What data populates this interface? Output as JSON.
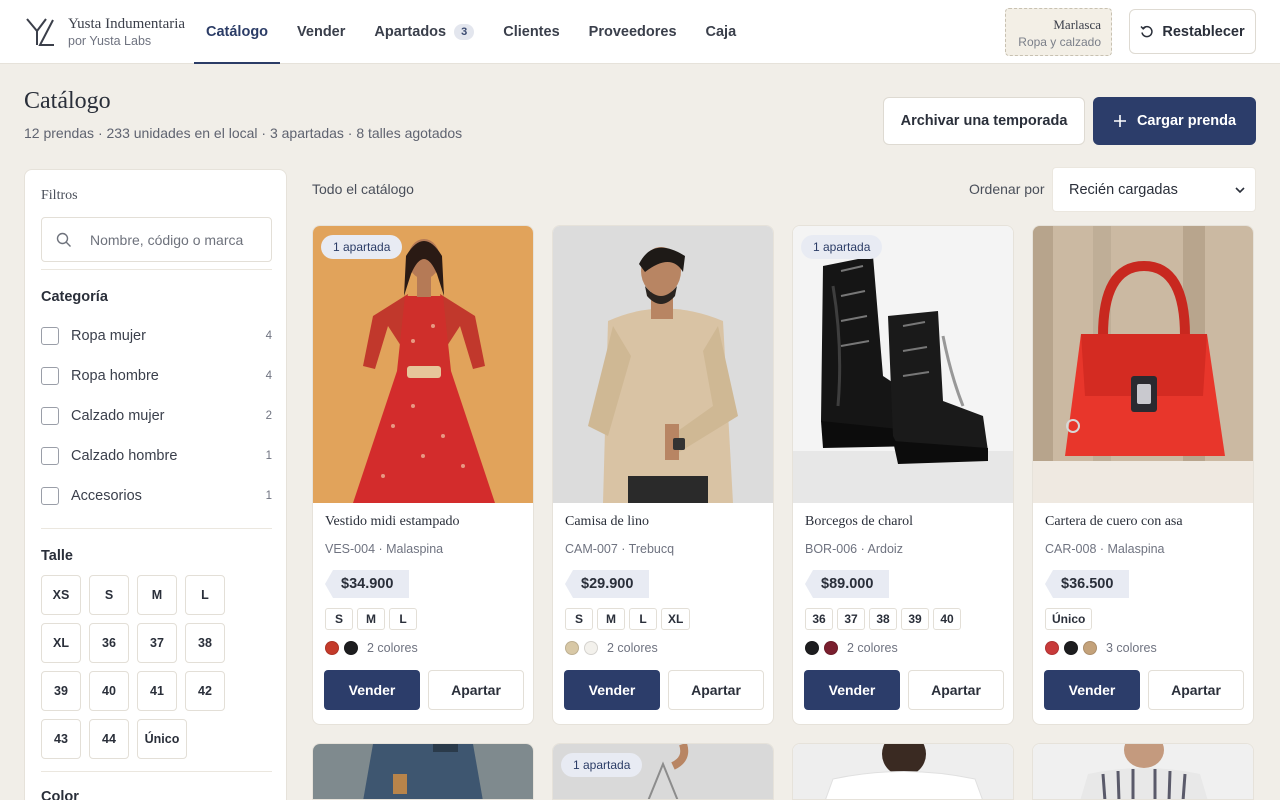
{
  "brand": {
    "name": "Yusta Indumentaria",
    "sub": "por Yusta Labs"
  },
  "nav": {
    "tabs": [
      {
        "label": "Catálogo",
        "active": true
      },
      {
        "label": "Vender"
      },
      {
        "label": "Apartados",
        "badge": "3"
      },
      {
        "label": "Clientes"
      },
      {
        "label": "Proveedores"
      },
      {
        "label": "Caja"
      }
    ]
  },
  "store": {
    "name": "Marlasca",
    "sub": "Ropa y calzado"
  },
  "reset_label": "Restablecer",
  "header": {
    "title": "Catálogo",
    "subtitle": "12 prendas · 233 unidades en el local · 3 apartadas · 8 talles agotados",
    "archive_label": "Archivar una temporada",
    "upload_label": "Cargar prenda"
  },
  "filters": {
    "title": "Filtros",
    "search_placeholder": "Nombre, código o marca",
    "category_heading": "Categoría",
    "categories": [
      {
        "label": "Ropa mujer",
        "count": "4"
      },
      {
        "label": "Ropa hombre",
        "count": "4"
      },
      {
        "label": "Calzado mujer",
        "count": "2"
      },
      {
        "label": "Calzado hombre",
        "count": "1"
      },
      {
        "label": "Accesorios",
        "count": "1"
      }
    ],
    "size_heading": "Talle",
    "sizes": [
      "XS",
      "S",
      "M",
      "L",
      "XL",
      "36",
      "37",
      "38",
      "39",
      "40",
      "41",
      "42",
      "43",
      "44",
      "Único"
    ],
    "color_heading": "Color"
  },
  "catalog": {
    "all_label": "Todo el catálogo",
    "sort_label": "Ordenar por",
    "sort_value": "Recién cargadas"
  },
  "products": [
    {
      "badge": "1 apartada",
      "name": "Vestido midi estampado",
      "code": "VES-004 · Malaspina",
      "price": "$34.900",
      "sizes": [
        "S",
        "M",
        "L"
      ],
      "colors": [
        "#c43a2a",
        "#1d1d1f"
      ],
      "colors_label": "2 colores",
      "sell": "Vender",
      "hold": "Apartar"
    },
    {
      "badge": "",
      "name": "Camisa de lino",
      "code": "CAM-007 · Trebucq",
      "price": "$29.900",
      "sizes": [
        "S",
        "M",
        "L",
        "XL"
      ],
      "colors": [
        "#d8c8a6",
        "#f3f1ec"
      ],
      "colors_label": "2 colores",
      "sell": "Vender",
      "hold": "Apartar"
    },
    {
      "badge": "1 apartada",
      "name": "Borcegos de charol",
      "code": "BOR-006 · Ardoiz",
      "price": "$89.000",
      "sizes": [
        "36",
        "37",
        "38",
        "39",
        "40"
      ],
      "colors": [
        "#1d1d1f",
        "#7a1f2e"
      ],
      "colors_label": "2 colores",
      "sell": "Vender",
      "hold": "Apartar"
    },
    {
      "badge": "",
      "name": "Cartera de cuero con asa",
      "code": "CAR-008 · Malaspina",
      "price": "$36.500",
      "sizes": [
        "Único"
      ],
      "colors": [
        "#c83a3a",
        "#1d1d1f",
        "#c4a27a"
      ],
      "colors_label": "3 colores",
      "sell": "Vender",
      "hold": "Apartar"
    },
    {
      "badge": ""
    },
    {
      "badge": "1 apartada"
    },
    {
      "badge": ""
    },
    {
      "badge": ""
    }
  ]
}
